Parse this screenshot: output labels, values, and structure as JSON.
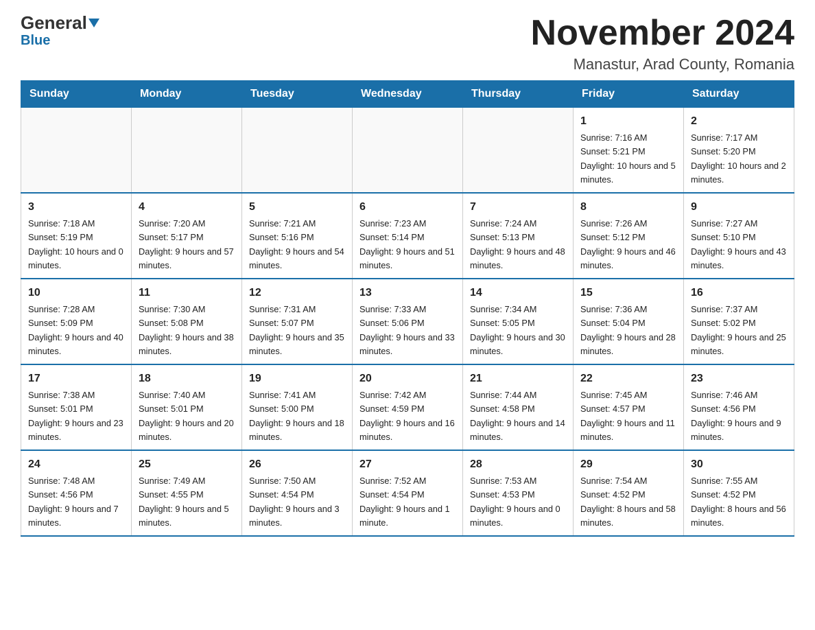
{
  "logo": {
    "text_general": "General",
    "text_blue": "Blue"
  },
  "header": {
    "month_year": "November 2024",
    "location": "Manastur, Arad County, Romania"
  },
  "weekdays": [
    "Sunday",
    "Monday",
    "Tuesday",
    "Wednesday",
    "Thursday",
    "Friday",
    "Saturday"
  ],
  "rows": [
    [
      {
        "day": "",
        "sunrise": "",
        "sunset": "",
        "daylight": ""
      },
      {
        "day": "",
        "sunrise": "",
        "sunset": "",
        "daylight": ""
      },
      {
        "day": "",
        "sunrise": "",
        "sunset": "",
        "daylight": ""
      },
      {
        "day": "",
        "sunrise": "",
        "sunset": "",
        "daylight": ""
      },
      {
        "day": "",
        "sunrise": "",
        "sunset": "",
        "daylight": ""
      },
      {
        "day": "1",
        "sunrise": "Sunrise: 7:16 AM",
        "sunset": "Sunset: 5:21 PM",
        "daylight": "Daylight: 10 hours and 5 minutes."
      },
      {
        "day": "2",
        "sunrise": "Sunrise: 7:17 AM",
        "sunset": "Sunset: 5:20 PM",
        "daylight": "Daylight: 10 hours and 2 minutes."
      }
    ],
    [
      {
        "day": "3",
        "sunrise": "Sunrise: 7:18 AM",
        "sunset": "Sunset: 5:19 PM",
        "daylight": "Daylight: 10 hours and 0 minutes."
      },
      {
        "day": "4",
        "sunrise": "Sunrise: 7:20 AM",
        "sunset": "Sunset: 5:17 PM",
        "daylight": "Daylight: 9 hours and 57 minutes."
      },
      {
        "day": "5",
        "sunrise": "Sunrise: 7:21 AM",
        "sunset": "Sunset: 5:16 PM",
        "daylight": "Daylight: 9 hours and 54 minutes."
      },
      {
        "day": "6",
        "sunrise": "Sunrise: 7:23 AM",
        "sunset": "Sunset: 5:14 PM",
        "daylight": "Daylight: 9 hours and 51 minutes."
      },
      {
        "day": "7",
        "sunrise": "Sunrise: 7:24 AM",
        "sunset": "Sunset: 5:13 PM",
        "daylight": "Daylight: 9 hours and 48 minutes."
      },
      {
        "day": "8",
        "sunrise": "Sunrise: 7:26 AM",
        "sunset": "Sunset: 5:12 PM",
        "daylight": "Daylight: 9 hours and 46 minutes."
      },
      {
        "day": "9",
        "sunrise": "Sunrise: 7:27 AM",
        "sunset": "Sunset: 5:10 PM",
        "daylight": "Daylight: 9 hours and 43 minutes."
      }
    ],
    [
      {
        "day": "10",
        "sunrise": "Sunrise: 7:28 AM",
        "sunset": "Sunset: 5:09 PM",
        "daylight": "Daylight: 9 hours and 40 minutes."
      },
      {
        "day": "11",
        "sunrise": "Sunrise: 7:30 AM",
        "sunset": "Sunset: 5:08 PM",
        "daylight": "Daylight: 9 hours and 38 minutes."
      },
      {
        "day": "12",
        "sunrise": "Sunrise: 7:31 AM",
        "sunset": "Sunset: 5:07 PM",
        "daylight": "Daylight: 9 hours and 35 minutes."
      },
      {
        "day": "13",
        "sunrise": "Sunrise: 7:33 AM",
        "sunset": "Sunset: 5:06 PM",
        "daylight": "Daylight: 9 hours and 33 minutes."
      },
      {
        "day": "14",
        "sunrise": "Sunrise: 7:34 AM",
        "sunset": "Sunset: 5:05 PM",
        "daylight": "Daylight: 9 hours and 30 minutes."
      },
      {
        "day": "15",
        "sunrise": "Sunrise: 7:36 AM",
        "sunset": "Sunset: 5:04 PM",
        "daylight": "Daylight: 9 hours and 28 minutes."
      },
      {
        "day": "16",
        "sunrise": "Sunrise: 7:37 AM",
        "sunset": "Sunset: 5:02 PM",
        "daylight": "Daylight: 9 hours and 25 minutes."
      }
    ],
    [
      {
        "day": "17",
        "sunrise": "Sunrise: 7:38 AM",
        "sunset": "Sunset: 5:01 PM",
        "daylight": "Daylight: 9 hours and 23 minutes."
      },
      {
        "day": "18",
        "sunrise": "Sunrise: 7:40 AM",
        "sunset": "Sunset: 5:01 PM",
        "daylight": "Daylight: 9 hours and 20 minutes."
      },
      {
        "day": "19",
        "sunrise": "Sunrise: 7:41 AM",
        "sunset": "Sunset: 5:00 PM",
        "daylight": "Daylight: 9 hours and 18 minutes."
      },
      {
        "day": "20",
        "sunrise": "Sunrise: 7:42 AM",
        "sunset": "Sunset: 4:59 PM",
        "daylight": "Daylight: 9 hours and 16 minutes."
      },
      {
        "day": "21",
        "sunrise": "Sunrise: 7:44 AM",
        "sunset": "Sunset: 4:58 PM",
        "daylight": "Daylight: 9 hours and 14 minutes."
      },
      {
        "day": "22",
        "sunrise": "Sunrise: 7:45 AM",
        "sunset": "Sunset: 4:57 PM",
        "daylight": "Daylight: 9 hours and 11 minutes."
      },
      {
        "day": "23",
        "sunrise": "Sunrise: 7:46 AM",
        "sunset": "Sunset: 4:56 PM",
        "daylight": "Daylight: 9 hours and 9 minutes."
      }
    ],
    [
      {
        "day": "24",
        "sunrise": "Sunrise: 7:48 AM",
        "sunset": "Sunset: 4:56 PM",
        "daylight": "Daylight: 9 hours and 7 minutes."
      },
      {
        "day": "25",
        "sunrise": "Sunrise: 7:49 AM",
        "sunset": "Sunset: 4:55 PM",
        "daylight": "Daylight: 9 hours and 5 minutes."
      },
      {
        "day": "26",
        "sunrise": "Sunrise: 7:50 AM",
        "sunset": "Sunset: 4:54 PM",
        "daylight": "Daylight: 9 hours and 3 minutes."
      },
      {
        "day": "27",
        "sunrise": "Sunrise: 7:52 AM",
        "sunset": "Sunset: 4:54 PM",
        "daylight": "Daylight: 9 hours and 1 minute."
      },
      {
        "day": "28",
        "sunrise": "Sunrise: 7:53 AM",
        "sunset": "Sunset: 4:53 PM",
        "daylight": "Daylight: 9 hours and 0 minutes."
      },
      {
        "day": "29",
        "sunrise": "Sunrise: 7:54 AM",
        "sunset": "Sunset: 4:52 PM",
        "daylight": "Daylight: 8 hours and 58 minutes."
      },
      {
        "day": "30",
        "sunrise": "Sunrise: 7:55 AM",
        "sunset": "Sunset: 4:52 PM",
        "daylight": "Daylight: 8 hours and 56 minutes."
      }
    ]
  ]
}
